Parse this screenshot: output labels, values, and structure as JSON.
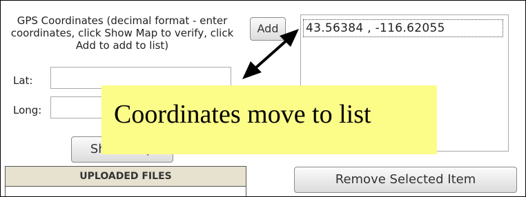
{
  "gps": {
    "instructions": "GPS Coordinates (decimal format - enter coordinates, click Show Map to verify, click Add to add to list)",
    "lat_label": "Lat:",
    "long_label": "Long:",
    "lat_value": "",
    "long_value": "",
    "add_button": "Add",
    "show_map_button": "Show Map"
  },
  "coordinate_list": {
    "items": [
      "43.56384 , -116.62055"
    ],
    "remove_button": "Remove Selected Item"
  },
  "uploaded_files": {
    "header": "UPLOADED FILES"
  },
  "annotation": {
    "text": "Coordinates move to list",
    "highlight_color": "#fcfc88",
    "arrow_icon": "double-headed-arrow-icon"
  }
}
